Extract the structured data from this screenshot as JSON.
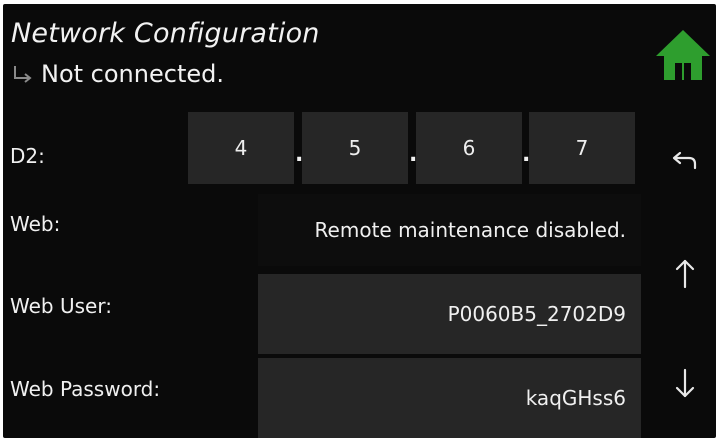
{
  "header": {
    "title": "Network Configuration",
    "status": "Not connected."
  },
  "icons": {
    "home": "home-icon",
    "back": "back-arrow-icon",
    "up": "arrow-up-icon",
    "down": "arrow-down-icon",
    "status": "return-arrow-icon"
  },
  "d2": {
    "label": "D2:",
    "octets": [
      "4",
      "5",
      "6",
      "7"
    ],
    "separator": "."
  },
  "web": {
    "label": "Web:",
    "value": "Remote maintenance disabled."
  },
  "web_user": {
    "label": "Web User:",
    "value": "P0060B5_2702D9"
  },
  "web_password": {
    "label": "Web Password:",
    "value": "kaqGHss6"
  },
  "colors": {
    "background": "#0a0a0a",
    "field": "#262626",
    "text": "#f0f0f0",
    "home_green": "#2e9e2e"
  }
}
